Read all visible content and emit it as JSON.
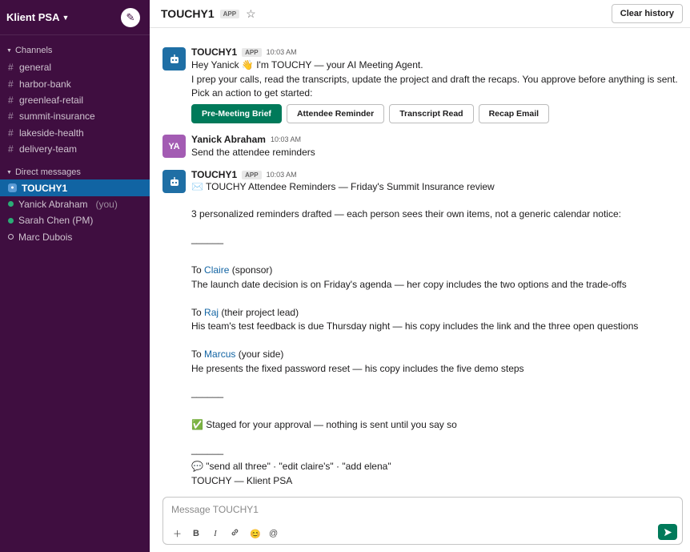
{
  "workspace": {
    "name": "Klient PSA"
  },
  "sidebar": {
    "channels_title": "Channels",
    "channels": [
      "general",
      "harbor-bank",
      "greenleaf-retail",
      "summit-insurance",
      "lakeside-health",
      "delivery-team"
    ],
    "dms_title": "Direct messages",
    "dms": [
      {
        "name": "TOUCHY1",
        "status": "bot",
        "active": true,
        "suffix": ""
      },
      {
        "name": "Yanick Abraham",
        "status": "online",
        "active": false,
        "suffix": "(you)"
      },
      {
        "name": "Sarah Chen (PM)",
        "status": "online",
        "active": false,
        "suffix": ""
      },
      {
        "name": "Marc Dubois",
        "status": "offline",
        "active": false,
        "suffix": ""
      }
    ]
  },
  "header": {
    "title": "TOUCHY1",
    "badge": "APP",
    "clear_label": "Clear history"
  },
  "messages": {
    "m1": {
      "sender": "TOUCHY1",
      "badge": "APP",
      "time": "10:03 AM",
      "line1": "Hey Yanick 👋 I'm TOUCHY — your AI Meeting Agent.",
      "line2": "I prep your calls, read the transcripts, update the project and draft the recaps. You approve before anything is sent.",
      "line3": "Pick an action to get started:",
      "actions": [
        "Pre-Meeting Brief",
        "Attendee Reminder",
        "Transcript Read",
        "Recap Email"
      ]
    },
    "m2": {
      "sender": "Yanick Abraham",
      "initials": "YA",
      "time": "10:03 AM",
      "text": "Send the attendee reminders"
    },
    "m3": {
      "sender": "TOUCHY1",
      "badge": "APP",
      "time": "10:03 AM",
      "title": "✉️ TOUCHY Attendee Reminders — Friday's Summit Insurance review",
      "intro": "3 personalized reminders drafted — each person sees their own items, not a generic calendar notice:",
      "divider": "______",
      "to_prefix": "To",
      "r1_name": "Claire",
      "r1_role": "(sponsor)",
      "r1_text": "The launch date decision is on Friday's agenda — her copy includes the two options and the trade-offs",
      "r2_name": "Raj",
      "r2_role": "(their project lead)",
      "r2_text": "His team's test feedback is due Thursday night — his copy includes the link and the three open questions",
      "r3_name": "Marcus",
      "r3_role": "(your side)",
      "r3_text": "He presents the fixed password reset — his copy includes the five demo steps",
      "staged": "✅ Staged for your approval — nothing is sent until you say so",
      "commands": "💬 \"send all three\" · \"edit claire's\" · \"add elena\"",
      "footer": "TOUCHY — Klient PSA"
    }
  },
  "composer": {
    "placeholder": "Message TOUCHY1"
  },
  "colors": {
    "sidebar": "#3f0e40",
    "active": "#1164a3",
    "primary": "#007a5a",
    "link": "#1264a3"
  }
}
